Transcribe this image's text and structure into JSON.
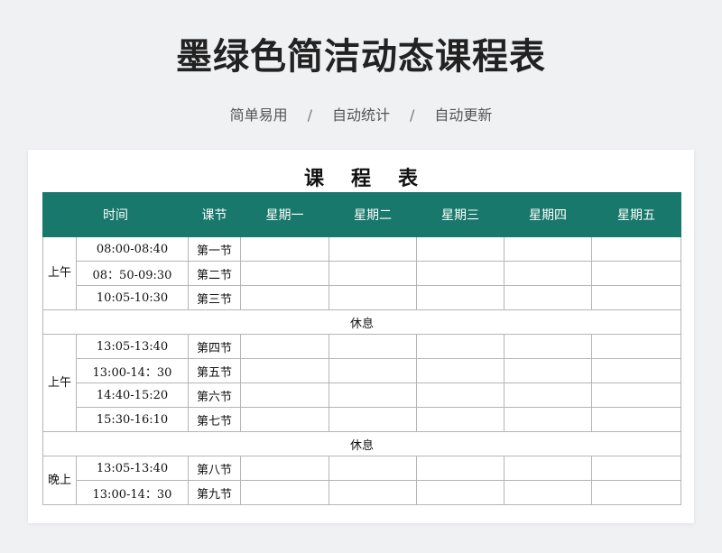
{
  "page": {
    "title": "墨绿色简洁动态课程表",
    "tags": [
      "简单易用",
      "自动统计",
      "自动更新"
    ],
    "separator": "/"
  },
  "sheet": {
    "title": "课程表",
    "columns": {
      "time": "时间",
      "lesson": "课节",
      "days": [
        "星期一",
        "星期二",
        "星期三",
        "星期四",
        "星期五"
      ]
    },
    "break_label": "休息",
    "groups": [
      {
        "period": "上午",
        "rows": [
          {
            "time": "08:00-08:40",
            "lesson": "第一节",
            "cells": [
              "",
              "",
              "",
              "",
              ""
            ]
          },
          {
            "time": "08：50-09:30",
            "lesson": "第二节",
            "cells": [
              "",
              "",
              "",
              "",
              ""
            ]
          },
          {
            "time": "10:05-10:30",
            "lesson": "第三节",
            "cells": [
              "",
              "",
              "",
              "",
              ""
            ]
          }
        ]
      },
      {
        "period": "上午",
        "rows": [
          {
            "time": "13:05-13:40",
            "lesson": "第四节",
            "cells": [
              "",
              "",
              "",
              "",
              ""
            ]
          },
          {
            "time": "13:00-14：30",
            "lesson": "第五节",
            "cells": [
              "",
              "",
              "",
              "",
              ""
            ]
          },
          {
            "time": "14:40-15:20",
            "lesson": "第六节",
            "cells": [
              "",
              "",
              "",
              "",
              ""
            ]
          },
          {
            "time": "15:30-16:10",
            "lesson": "第七节",
            "cells": [
              "",
              "",
              "",
              "",
              ""
            ]
          }
        ]
      },
      {
        "period": "晚上",
        "rows": [
          {
            "time": "13:05-13:40",
            "lesson": "第八节",
            "cells": [
              "",
              "",
              "",
              "",
              ""
            ]
          },
          {
            "time": "13:00-14：30",
            "lesson": "第九节",
            "cells": [
              "",
              "",
              "",
              "",
              ""
            ]
          }
        ]
      }
    ]
  },
  "colors": {
    "header_bg": "#18786b",
    "page_bg": "#f0f1f3",
    "grid": "#b5b5b5"
  }
}
